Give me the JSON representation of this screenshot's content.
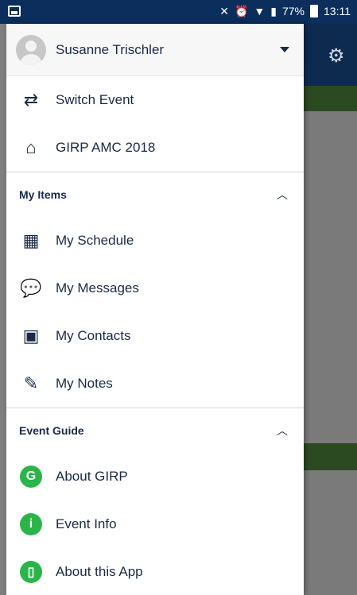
{
  "status_bar": {
    "battery": "77%",
    "time": "13:11"
  },
  "background_app": {
    "header_icon": "profile-settings-icon"
  },
  "drawer": {
    "user_name": "Susanne Trischler",
    "top_items": [
      {
        "label": "Switch Event",
        "icon": "switch-arrows-icon"
      },
      {
        "label": "GIRP AMC 2018",
        "icon": "home-icon"
      }
    ],
    "my_items": {
      "title": "My Items",
      "items": [
        {
          "label": "My Schedule",
          "icon": "calendar-add-icon"
        },
        {
          "label": "My Messages",
          "icon": "chat-bubbles-icon"
        },
        {
          "label": "My Contacts",
          "icon": "contact-card-icon"
        },
        {
          "label": "My Notes",
          "icon": "note-edit-icon"
        }
      ]
    },
    "event_guide": {
      "title": "Event Guide",
      "items": [
        {
          "label": "About GIRP",
          "icon": "girp-logo-icon"
        },
        {
          "label": "Event Info",
          "icon": "info-icon"
        },
        {
          "label": "About this App",
          "icon": "phone-app-icon"
        }
      ]
    }
  },
  "colors": {
    "brand_green": "#2bb44a",
    "header_navy": "#0b2e5c",
    "text_navy": "#1a2a44"
  }
}
